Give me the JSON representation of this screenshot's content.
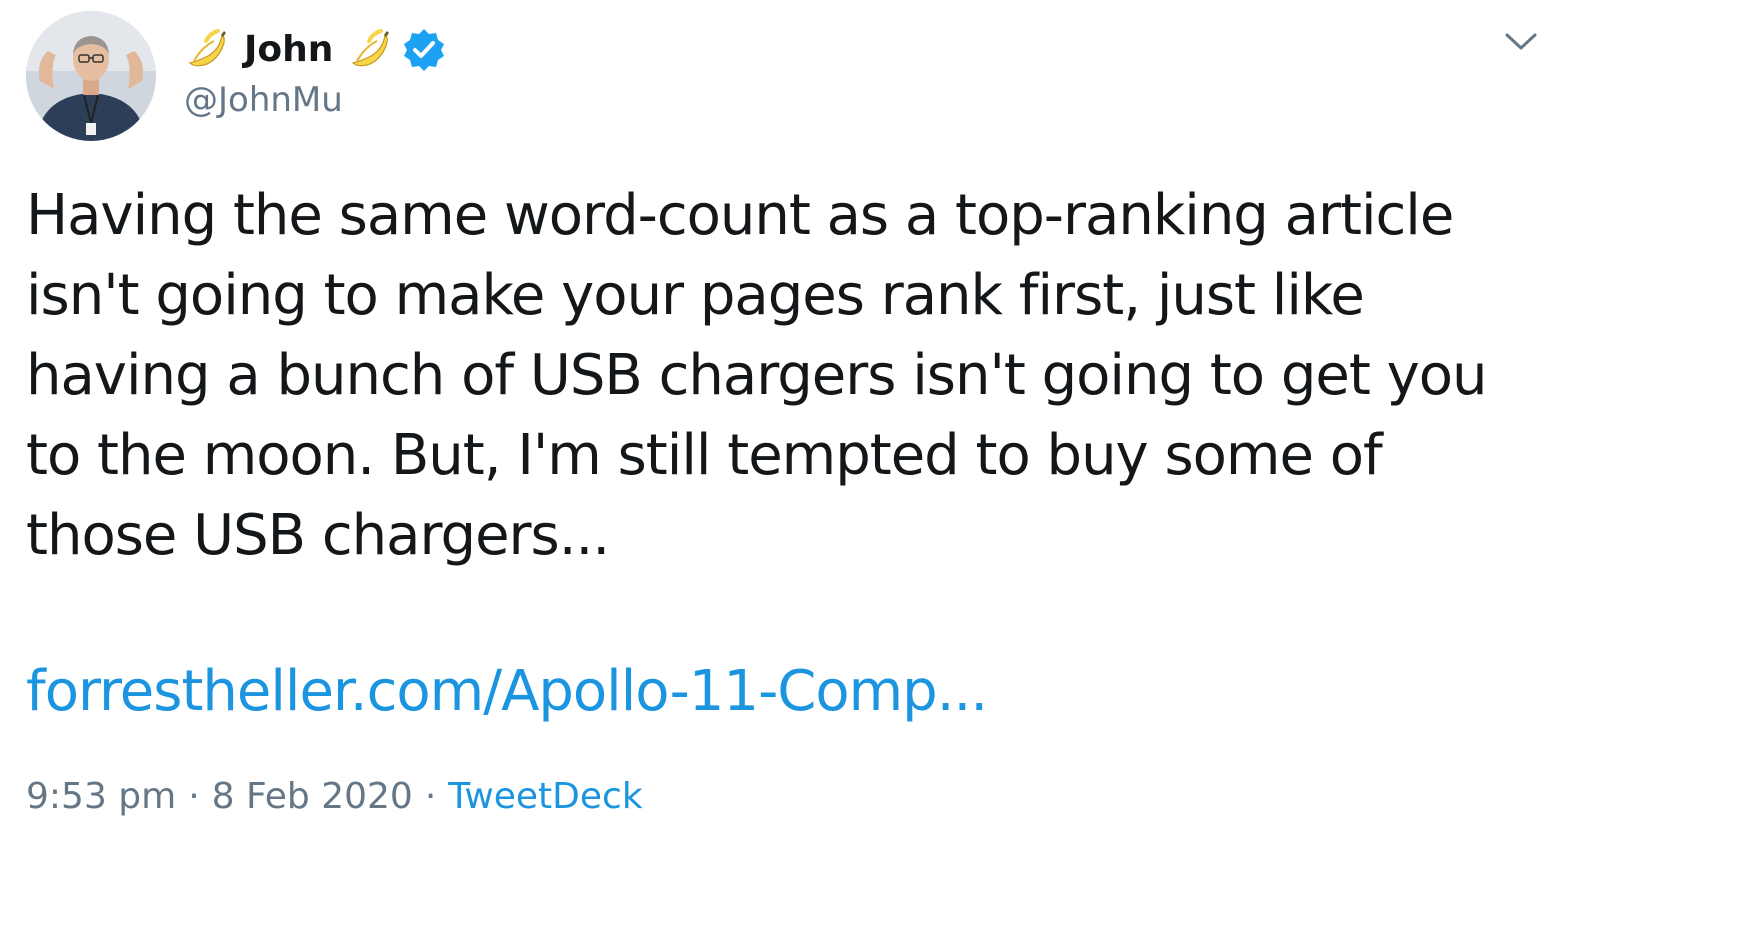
{
  "author": {
    "display_name": "John",
    "handle": "@JohnMu",
    "verified": true,
    "name_emoji": "banana-emoji"
  },
  "tweet": {
    "text": "Having the same word-count as a top-ranking article\nisn't going to make your pages rank first, just like\nhaving a bunch of USB chargers isn't going to get you\nto the moon. But, I'm still tempted to buy some of\nthose USB chargers...",
    "link": "forrestheller.com/Apollo-11-Comp..."
  },
  "meta": {
    "time": "9:53 pm",
    "separator_1": "·",
    "date": "8 Feb 2020",
    "separator_2": "·",
    "source": "TweetDeck"
  },
  "colors": {
    "text": "#14171a",
    "secondary": "#657786",
    "link": "#1b95e0",
    "verified_badge": "#1da1f2"
  },
  "icons": {
    "menu": "chevron-down-icon",
    "verified": "verified-badge-icon"
  }
}
